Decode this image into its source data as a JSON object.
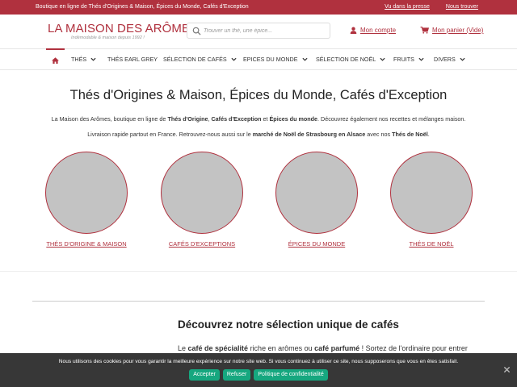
{
  "topbar": {
    "tagline": "Boutique en ligne de Thés d'Origines & Maison, Épices du Monde, Cafés d'Exception",
    "links": [
      "Vu dans la presse",
      "Nous trouver"
    ]
  },
  "header": {
    "logo_title": "LA MAISON DES ARÔMES",
    "logo_subtitle": "Indémodable & maison depuis 1992 !",
    "search_placeholder": "Trouver un thé, une épice...",
    "account_label": "Mon compte",
    "cart_label": "Mon panier (Vide)"
  },
  "nav": {
    "items": [
      {
        "label": "THÉS",
        "dropdown": true
      },
      {
        "label": "THÉS EARL GREY",
        "dropdown": false
      },
      {
        "label": "SÉLECTION DE CAFÉS",
        "dropdown": true
      },
      {
        "label": "EPICES DU MONDE",
        "dropdown": true
      },
      {
        "label": "SÉLECTION DE NOËL",
        "dropdown": true
      },
      {
        "label": "FRUITS",
        "dropdown": true
      },
      {
        "label": "DIVERS",
        "dropdown": true
      }
    ]
  },
  "main": {
    "title": "Thés d'Origines & Maison, Épices du Monde, Cafés d'Exception",
    "intro1": {
      "a": "La Maison des Arômes, boutique en ligne de ",
      "b1": "Thés d'Origine",
      "c": ", ",
      "b2": "Cafés d'Exception",
      "d": " et ",
      "b3": "Épices du monde",
      "e": ". Découvrez également nos recettes et mélanges maison."
    },
    "intro2": {
      "a": "Livraison rapide partout en France. Retrouvez-nous aussi sur le ",
      "b1": "marché de Noël de Strasbourg en Alsace",
      "c": " avec nos ",
      "b2": "Thés de Noël",
      "d": "."
    },
    "categories": [
      {
        "label": "THÉS D'ORIGINE & MAISON"
      },
      {
        "label": "CAFÉS D'EXCEPTIONS"
      },
      {
        "label": "ÉPICES DU MONDE"
      },
      {
        "label": "THÉS DE NOËL"
      }
    ],
    "section_title": "Découvrez notre sélection unique de cafés",
    "section_text": {
      "a": "Le ",
      "b1": "café de spécialité",
      "c": " riche en arômes ou ",
      "b2": "café parfumé",
      "d": " ! Sortez de l'ordinaire pour entrer"
    }
  },
  "cookie": {
    "message": "Nous utilisons des cookies pour vous garantir la meilleure expérience sur notre site web. Si vous continuez à utiliser ce site, nous supposerons que vous en êtes satisfait.",
    "accept": "Accepter",
    "refuse": "Refuser",
    "privacy": "Politique de confidentialité"
  },
  "colors": {
    "brand": "#b0313e",
    "cookie_button": "#16a77f",
    "cookie_bg": "#282828"
  }
}
